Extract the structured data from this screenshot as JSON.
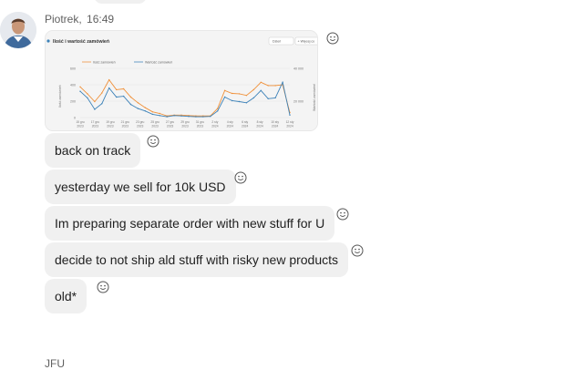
{
  "message_group": {
    "sender": "Piotrek",
    "time": "16:49",
    "separator": ",",
    "image": {
      "chart_data": {
        "type": "line",
        "title": "Ilość i wartość zamówień",
        "controls": {
          "period": "Dzień",
          "button": "+ Więcej co"
        },
        "legend": [
          "Ilość zamówień",
          "Wartość zamówień"
        ],
        "ylabel_left": "Ilość zamówień",
        "ylabel_right": "Wartość zamówień",
        "yticks_left": [
          "600",
          "400",
          "200",
          "0"
        ],
        "yticks_right": [
          "40 000",
          "20 000"
        ],
        "categories": [
          "15 gru 2023",
          "17 gru 2023",
          "19 gru 2023",
          "21 gru 2023",
          "23 gru 2023",
          "25 gru 2023",
          "27 gru 2023",
          "29 gru 2023",
          "31 gru 2023",
          "2 sty 2024",
          "4 sty 2024",
          "6 sty 2024",
          "8 sty 2024",
          "10 sty 2024",
          "12 sty 2024"
        ],
        "ylim": [
          0,
          600
        ],
        "series": [
          {
            "name": "Ilość zamówień",
            "color": "#f0913a",
            "values": [
              375,
              290,
              195,
              300,
              460,
              340,
              350,
              250,
              180,
              120,
              70,
              50,
              20,
              30,
              30,
              25,
              20,
              20,
              20,
              110,
              330,
              295,
              290,
              270,
              340,
              430,
              390,
              390,
              400,
              60
            ]
          },
          {
            "name": "Wartość zamówień",
            "color": "#3d82b8",
            "values": [
              320,
              240,
              100,
              170,
              360,
              250,
              260,
              160,
              110,
              80,
              40,
              25,
              10,
              25,
              20,
              15,
              10,
              10,
              15,
              80,
              250,
              205,
              195,
              180,
              240,
              330,
              230,
              240,
              430,
              30
            ]
          }
        ]
      }
    },
    "messages": [
      {
        "text": "back on track"
      },
      {
        "text": "yesterday we sell for 10k USD"
      },
      {
        "text": "Im preparing separate order with new stuff for U"
      },
      {
        "text": "decide to not ship ald stuff with risky new products"
      },
      {
        "text": "old*"
      }
    ]
  },
  "next_sender": "JFU"
}
